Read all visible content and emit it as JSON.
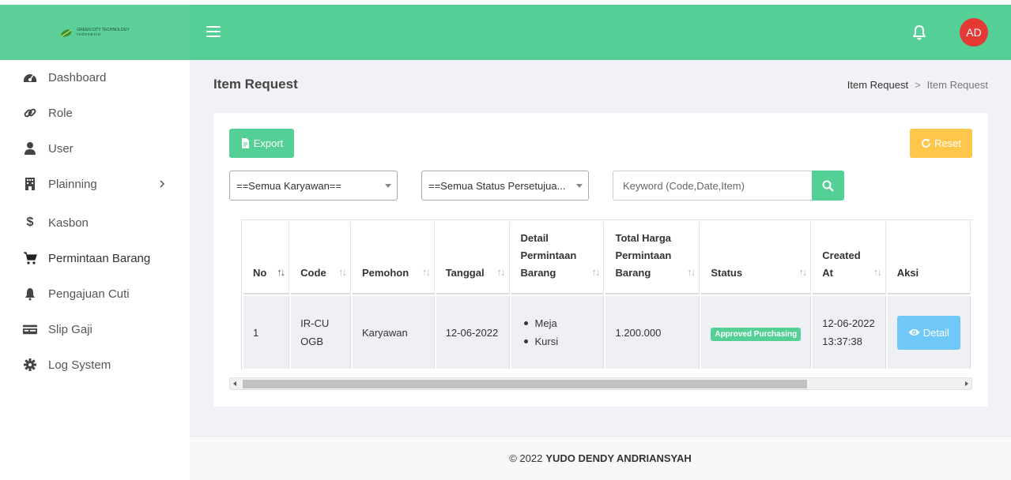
{
  "brand": {
    "line1": "GREEN CITY TECHNOLOGY",
    "line2": "Indonesia"
  },
  "header": {
    "avatar_initials": "AD",
    "accent_color": "#54cf95"
  },
  "sidebar": {
    "items": [
      {
        "label": "Dashboard",
        "icon": "dashboard-icon"
      },
      {
        "label": "Role",
        "icon": "link-icon"
      },
      {
        "label": "User",
        "icon": "user-icon"
      },
      {
        "label": "Plainning",
        "icon": "building-icon",
        "has_submenu": true
      },
      {
        "label": "Kasbon",
        "icon": "dollar-icon"
      },
      {
        "label": "Permintaan Barang",
        "icon": "cart-icon"
      },
      {
        "label": "Pengajuan Cuti",
        "icon": "bell-icon"
      },
      {
        "label": "Slip Gaji",
        "icon": "card-icon"
      },
      {
        "label": "Log System",
        "icon": "gear-icon"
      }
    ]
  },
  "page": {
    "title": "Item Request",
    "breadcrumb": [
      "Item Request",
      "Item Request"
    ]
  },
  "toolbar": {
    "export_label": "Export",
    "reset_label": "Reset",
    "employee_filter": "==Semua Karyawan==",
    "status_filter": "==Semua Status Persetujua...",
    "search_placeholder": "Keyword (Code,Date,Item)"
  },
  "table": {
    "headers": [
      "No",
      "Code",
      "Pemohon",
      "Tanggal",
      "Detail Permintaan Barang",
      "Total Harga Permintaan Barang",
      "Status",
      "Created At",
      "Aksi"
    ],
    "rows": [
      {
        "no": "1",
        "code": "IR-CUOGB",
        "pemohon": "Karyawan",
        "tanggal": "12-06-2022",
        "items": [
          "Meja",
          "Kursi"
        ],
        "total": "1.200.000",
        "status": "Approved Purchasing",
        "created_date": "12-06-2022",
        "created_time": "13:37:38",
        "action_label": "Detail"
      }
    ]
  },
  "footer": {
    "copyright": "© 2022",
    "author": "YUDO DENDY ANDRIANSYAH"
  }
}
